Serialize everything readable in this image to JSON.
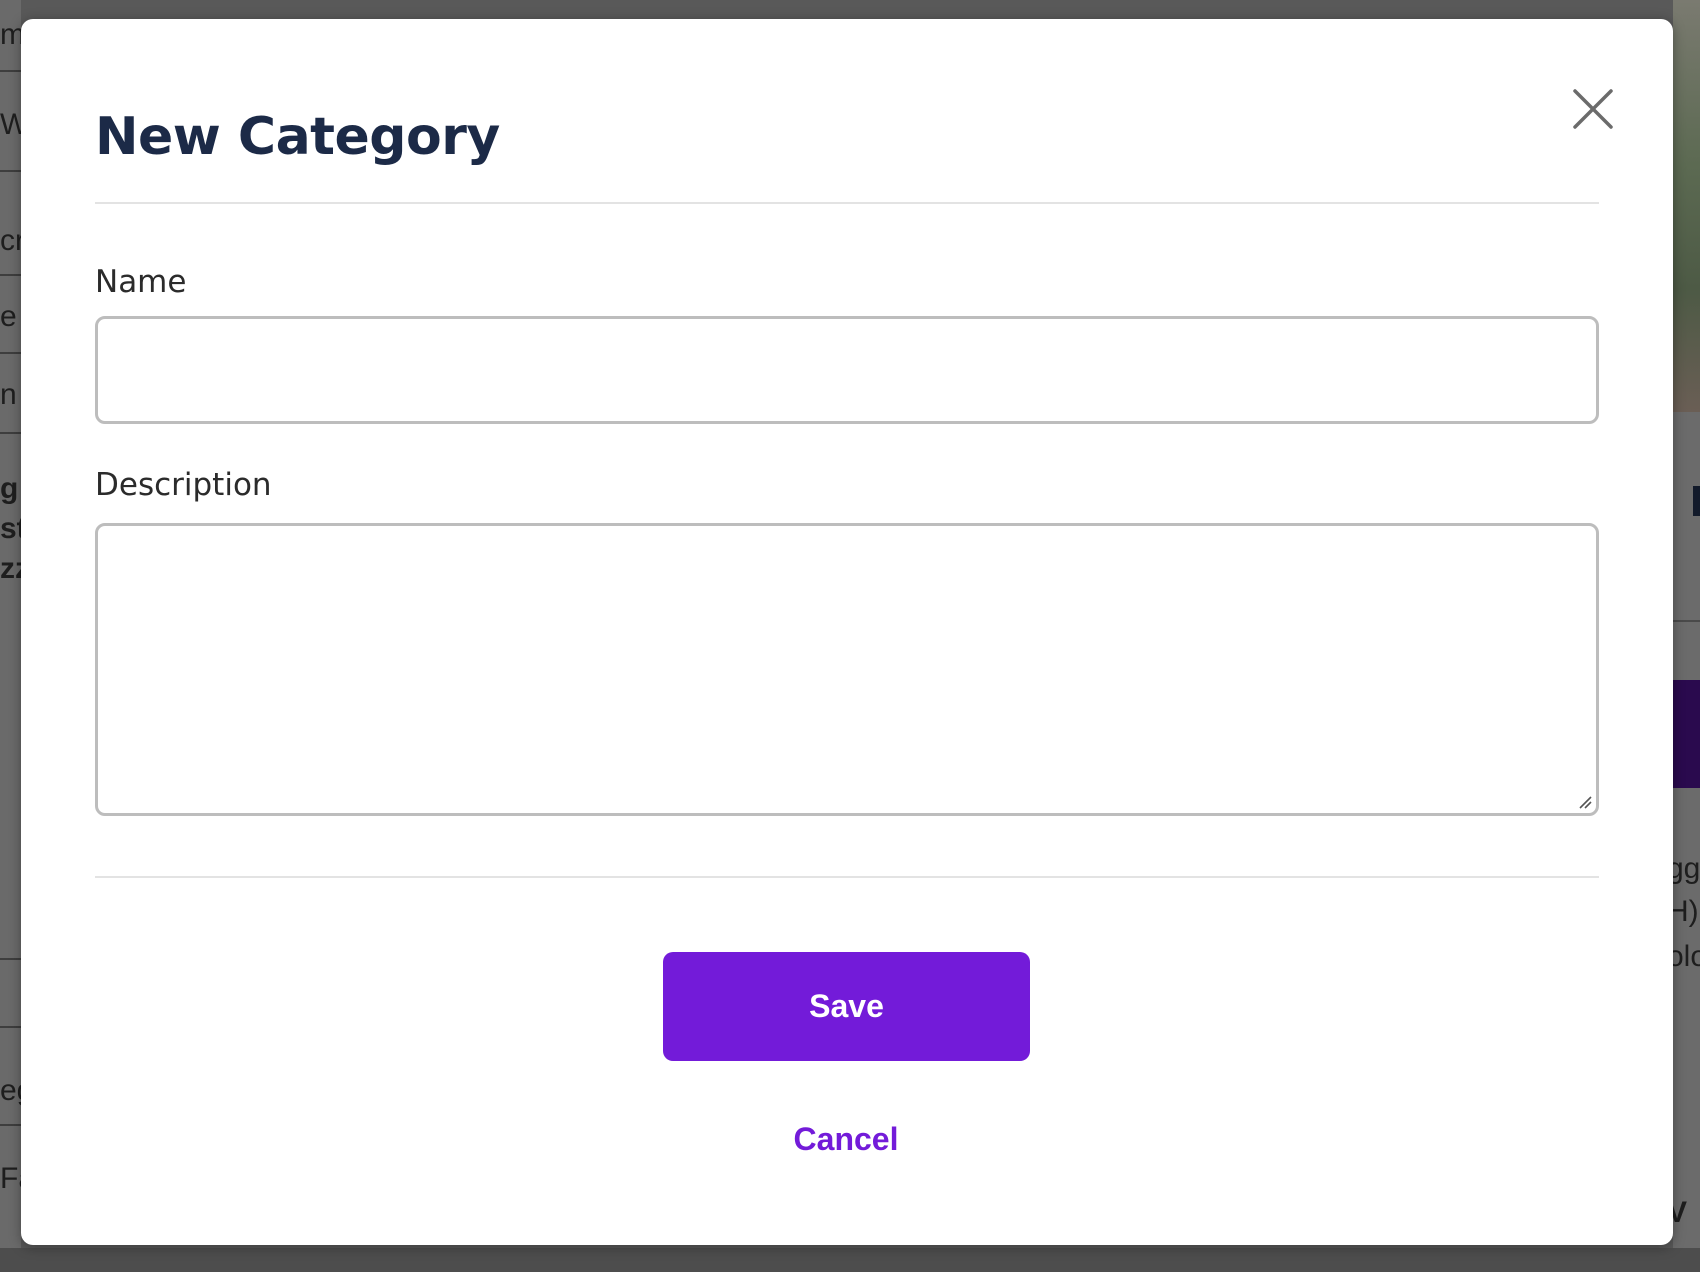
{
  "modal": {
    "title": "New Category",
    "close_icon": "close-icon",
    "fields": {
      "name": {
        "label": "Name",
        "value": "",
        "placeholder": ""
      },
      "description": {
        "label": "Description",
        "value": "",
        "placeholder": ""
      }
    },
    "actions": {
      "save_label": "Save",
      "cancel_label": "Cancel"
    }
  },
  "background_fragments": {
    "left": [
      "me",
      "Wi",
      "cr",
      "e",
      "n",
      "g",
      "st",
      "zz",
      "eg",
      "Fa"
    ],
    "right": [
      "gg",
      "H)",
      "olo",
      "V"
    ]
  },
  "colors": {
    "accent": "#731bd9",
    "title": "#1c2a47",
    "input_border": "#bdbdbd",
    "overlay": "#4a4a4a"
  }
}
